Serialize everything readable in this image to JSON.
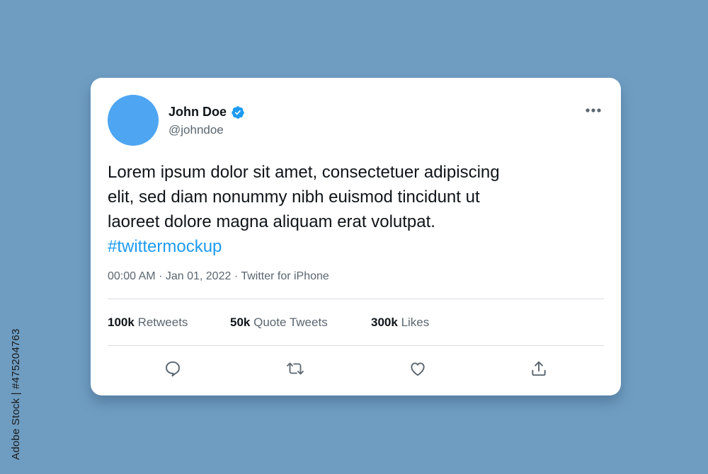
{
  "watermark_side_text": "Adobe Stock | #475204763",
  "colors": {
    "background": "#6f9dc2",
    "avatar": "#4ea5f2",
    "verified": "#1d9bf0",
    "link": "#1d9bf0",
    "secondary_text": "#5b6670"
  },
  "tweet": {
    "author": {
      "display_name": "John Doe",
      "handle": "@johndoe",
      "verified_icon": "verified-badge-icon"
    },
    "text_lines": [
      "Lorem ipsum dolor sit amet, consectetuer adipiscing",
      "elit, sed diam nonummy nibh euismod tincidunt ut",
      "laoreet dolore magna aliquam erat volutpat."
    ],
    "hashtag": "#twittermockup",
    "time": "00:00 AM",
    "date": "Jan 01, 2022",
    "source": "Twitter for iPhone",
    "meta_sep": "·",
    "stats": {
      "retweets": {
        "count": "100k",
        "label": "Retweets"
      },
      "quote_tweets": {
        "count": "50k",
        "label": "Quote Tweets"
      },
      "likes": {
        "count": "300k",
        "label": "Likes"
      }
    },
    "actions": [
      "reply-icon",
      "retweet-icon",
      "like-icon",
      "share-icon"
    ]
  }
}
